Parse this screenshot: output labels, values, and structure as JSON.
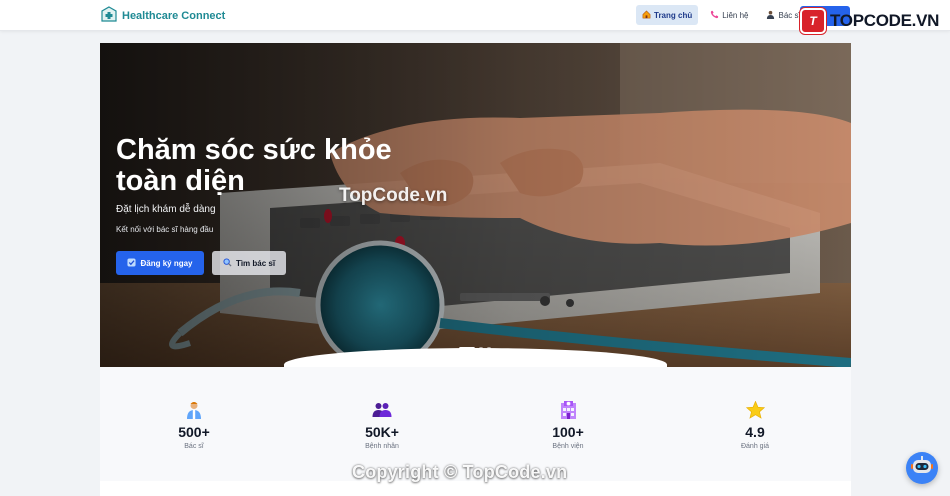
{
  "header": {
    "brand": "Healthcare Connect",
    "nav": [
      {
        "label": "Trang chủ",
        "icon": "house-icon",
        "active": true
      },
      {
        "label": "Liên hệ",
        "icon": "phone-icon",
        "active": false
      },
      {
        "label": "Bác sĩ",
        "icon": "doctor-icon",
        "active": false
      }
    ],
    "accent": "#2563eb",
    "brand_color": "#1f8a94"
  },
  "watermark": {
    "logo_text": "TOPCODE.VN",
    "center_text": "TopCode.vn",
    "copyright": "Copyright © TopCode.vn"
  },
  "hero": {
    "title": "Chăm sóc sức khỏe toàn diện",
    "subtitle": "Đặt lịch khám dễ dàng",
    "subtitle2": "Kết nối với bác sĩ hàng đầu",
    "primary_button": "Đăng ký ngay",
    "secondary_button": "Tìm bác sĩ",
    "slides_total": 3,
    "active_slide": 1
  },
  "stats": [
    {
      "value": "500+",
      "label": "Bác sĩ",
      "icon": "doctor-icon"
    },
    {
      "value": "50K+",
      "label": "Bệnh nhân",
      "icon": "patients-icon"
    },
    {
      "value": "100+",
      "label": "Bệnh viện",
      "icon": "hospital-icon"
    },
    {
      "value": "4.9",
      "label": "Đánh giá",
      "icon": "star-icon"
    }
  ]
}
